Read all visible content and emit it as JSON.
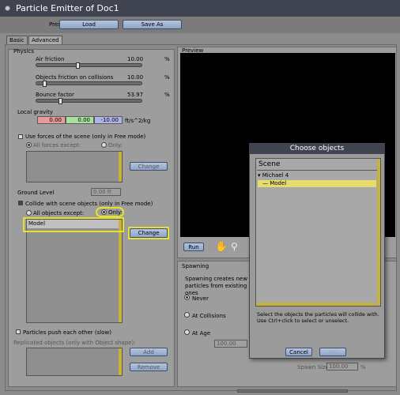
{
  "window": {
    "title": "Particle Emitter of Doc1"
  },
  "toolbar": {
    "preset_label": "Preset:",
    "load_label": "Load",
    "save_as_label": "Save As"
  },
  "tabs": [
    {
      "label": "Basic"
    },
    {
      "label": "Advanced"
    }
  ],
  "physics": {
    "title": "Physics",
    "sliders": [
      {
        "label": "Air friction",
        "value": "10.00",
        "unit": "%",
        "fraction": 0.1
      },
      {
        "label": "Objects friction on collisions",
        "value": "10.00",
        "unit": "%",
        "fraction": 0.1
      },
      {
        "label": "Bounce factor",
        "value": "53.97",
        "unit": "%",
        "fraction": 0.54
      }
    ],
    "local_gravity": {
      "label": "Local gravity",
      "x": "0.00",
      "y": "0.00",
      "z": "-10.00",
      "unit": "ft/s^2/kg",
      "colors": {
        "x": "#e89a9a",
        "y": "#a8e0a0",
        "z": "#b0b4e6"
      }
    },
    "forces": {
      "checkbox_label": "Use forces of the scene (only in Free mode)",
      "all_except": "All forces except:",
      "only": "Only:",
      "change": "Change"
    },
    "ground_level": {
      "label": "Ground Level",
      "value": "0.00 ft"
    },
    "collide": {
      "checkbox_label": "Collide with scene objects (only in Free mode)",
      "all_except": "All objects except:",
      "only": "Only:",
      "list": [
        "Model"
      ],
      "change": "Change"
    },
    "push": {
      "checkbox_label": "Particles push each other (slow)"
    },
    "replicated": {
      "label": "Replicated objects (only with Object shape):",
      "add": "Add",
      "remove": "Remove"
    }
  },
  "preview": {
    "title": "Preview",
    "run_label": "Run"
  },
  "spawning": {
    "title": "Spawning",
    "description": "Spawning creates new particles from existing ones",
    "never": "Never",
    "at_collisions": "At Collisions",
    "at_age": "At Age",
    "age_value": "100.00",
    "spawn_size_label": "Spawn Size",
    "spawn_size_value": "100.00",
    "spawn_size_unit": "%"
  },
  "dialog": {
    "title": "Choose objects",
    "scene_header": "Scene",
    "tree": [
      {
        "label": "Michael 4"
      },
      {
        "label": "Model"
      }
    ],
    "help": "Select the objects the particles will collide with. Use Ctrl+click to select or unselect.",
    "cancel": "Cancel",
    "ok": "OK"
  },
  "colors": {
    "highlight_yellow": "#e8e030",
    "selected_row": "#e6dc6e",
    "titlebar": "#3f4450"
  }
}
